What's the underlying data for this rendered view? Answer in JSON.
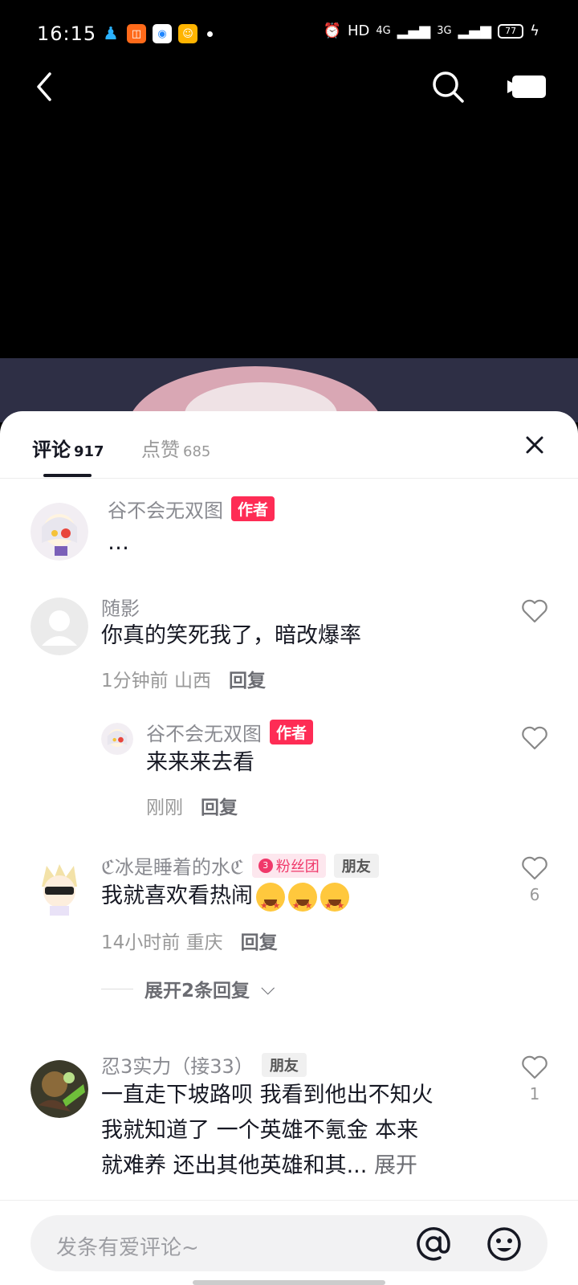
{
  "status_bar": {
    "time": "16:15",
    "hd": "HD",
    "net1": "4G",
    "net2": "3G",
    "battery": "77"
  },
  "tabs": {
    "comments_label": "评论",
    "comments_count": "917",
    "likes_label": "点赞",
    "likes_count": "685"
  },
  "comments": [
    {
      "username": "谷不会无双图",
      "badge": "作者",
      "text": "…"
    },
    {
      "username": "随影",
      "text": "你真的笑死我了，暗改爆率",
      "time": "1分钟前",
      "location": "山西",
      "reply_label": "回复"
    },
    {
      "username": "谷不会无双图",
      "badge": "作者",
      "text": "来来来去看",
      "time": "刚刚",
      "reply_label": "回复"
    },
    {
      "username": "ℭ冰是睡着的水ℭ",
      "fan_badge": "粉丝团",
      "fan_level": "3",
      "friend_badge": "朋友",
      "text": "我就喜欢看热闹",
      "time": "14小时前",
      "location": "重庆",
      "reply_label": "回复",
      "likes": "6",
      "expand_label": "展开2条回复"
    },
    {
      "username": "忍3实力（接33）",
      "friend_badge": "朋友",
      "text_line1": "一直走下坡路呗 我看到他出不知火",
      "text_line2": "我就知道了 一个英雄不氪金 本来",
      "text_line3": "就难养 还出其他英雄和其...",
      "more_label": "展开",
      "likes": "1"
    }
  ],
  "input": {
    "placeholder": "发条有爱评论~"
  },
  "colors": {
    "accent": "#fe2c55",
    "text": "#161823",
    "muted": "#999999"
  }
}
